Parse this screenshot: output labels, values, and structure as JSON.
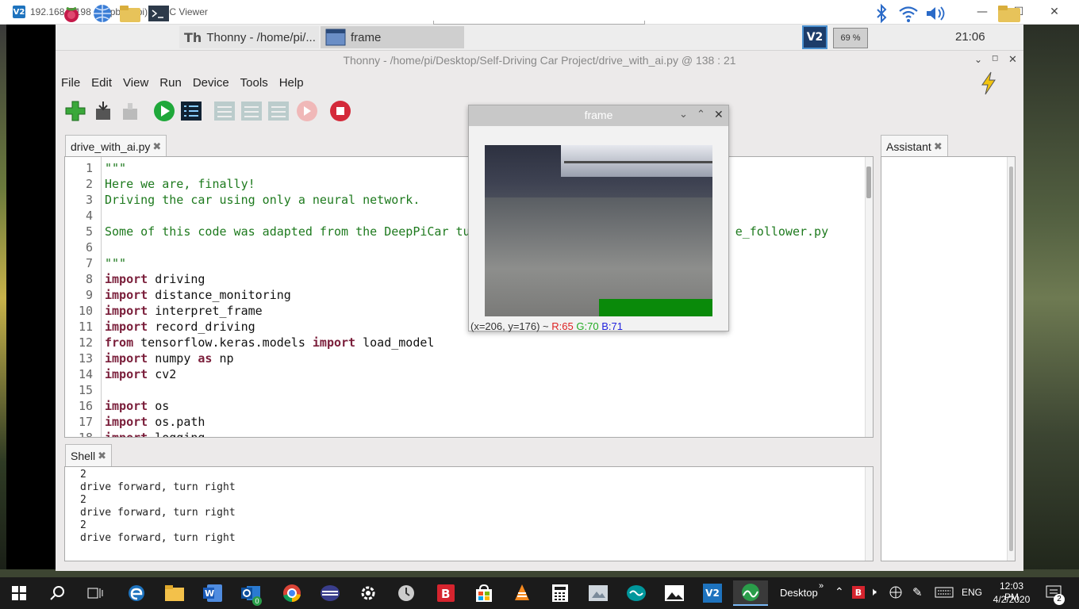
{
  "vnc": {
    "title": "192.168.0.198 (raspberrypi) - VNC Viewer",
    "logo": "V2"
  },
  "pi_panel": {
    "tasks": [
      {
        "label": "Thonny  -  /home/pi/..."
      },
      {
        "label": "frame"
      }
    ],
    "vnc_label": "V2",
    "battery": "69 %",
    "clock": "21:06"
  },
  "thonny": {
    "title": "Thonny  -  /home/pi/Desktop/Self-Driving Car Project/drive_with_ai.py  @  138 : 21",
    "menu": [
      "File",
      "Edit",
      "View",
      "Run",
      "Device",
      "Tools",
      "Help"
    ],
    "editor_tab": "drive_with_ai.py",
    "shell_tab": "Shell",
    "assistant_tab": "Assistant",
    "line_numbers": [
      "1",
      "2",
      "3",
      "4",
      "5",
      "6",
      "7",
      "8",
      "9",
      "10",
      "11",
      "12",
      "13",
      "14",
      "15",
      "16",
      "17",
      "18"
    ],
    "shell_lines": [
      "2",
      "drive forward, turn right",
      "2",
      "drive forward, turn right",
      "2",
      "drive forward, turn right"
    ]
  },
  "frame_window": {
    "title": "frame",
    "status": {
      "coords": "(x=206, y=176) ~",
      "r": "R:65",
      "g": "G:70",
      "b": "B:71"
    }
  },
  "taskbar": {
    "desktop_label": "Desktop",
    "lang": "ENG",
    "time": "12:03 PM",
    "date": "4/2/2020",
    "notif_count": "2",
    "vnc_label": "V2",
    "outlook_badge": "0"
  },
  "colors": {
    "accent_green": "#0a8a0a",
    "vnc_blue": "#1e73be",
    "keyword": "#7a1e3a",
    "string": "#1e7a1e"
  }
}
